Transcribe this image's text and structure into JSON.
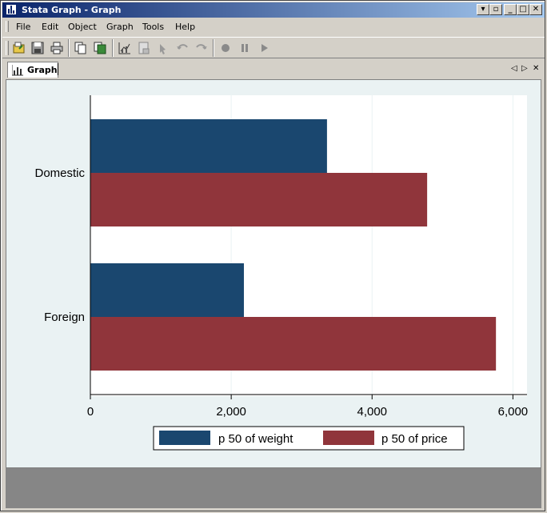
{
  "window": {
    "title": "Stata Graph - Graph",
    "controls": [
      "restore-menu",
      "restore",
      "minimize",
      "maximize",
      "close"
    ]
  },
  "menu": [
    "File",
    "Edit",
    "Object",
    "Graph",
    "Tools",
    "Help"
  ],
  "toolbar": {
    "buttons": [
      "open-icon",
      "save-icon",
      "print-icon",
      "copy-icon",
      "export-icon",
      "graph-editor-icon",
      "properties-icon",
      "pointer-icon",
      "undo-icon",
      "redo-icon",
      "record-icon",
      "pause-icon",
      "play-icon"
    ]
  },
  "tabs": {
    "active": "Graph"
  },
  "colors": {
    "plot_bg": "#ffffff",
    "graph_bg": "#eaf2f3",
    "series_weight": "#1a476f",
    "series_price": "#90353b",
    "bottom_panel": "#868686"
  },
  "chart_data": {
    "type": "bar",
    "orientation": "horizontal",
    "categories": [
      "Domestic",
      "Foreign"
    ],
    "series": [
      {
        "name": "p 50 of weight",
        "values": [
          3360,
          2180
        ]
      },
      {
        "name": "p 50 of price",
        "values": [
          4782,
          5759
        ]
      }
    ],
    "xlim": [
      0,
      6200
    ],
    "xticks": [
      0,
      2000,
      4000,
      6000
    ],
    "xtick_labels": [
      "0",
      "2,000",
      "4,000",
      "6,000"
    ],
    "grid": true,
    "legend": "bottom"
  }
}
